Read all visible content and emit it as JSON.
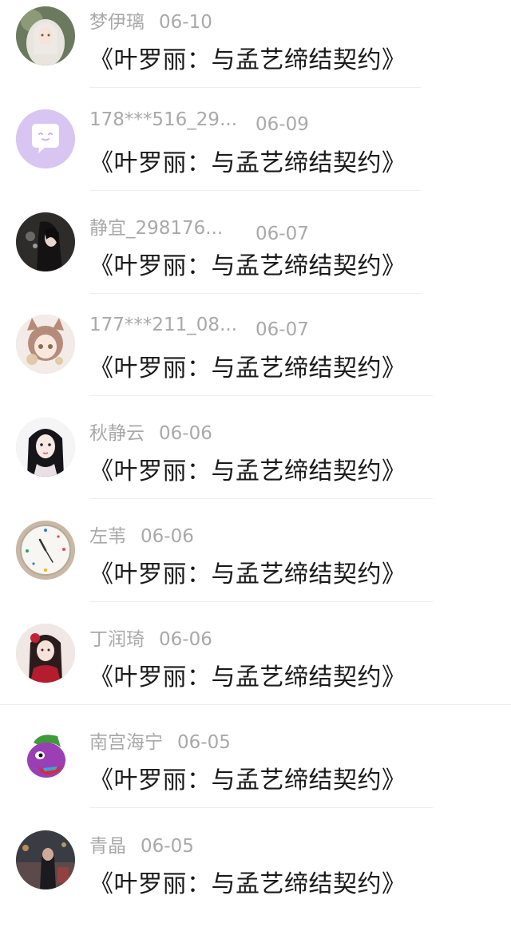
{
  "comments": [
    {
      "name": "梦伊璃",
      "date": "06-10",
      "text": "《叶罗丽：与孟艺缔结契约》",
      "avatar": "girl-white-hair-avatar"
    },
    {
      "name": "178***516_29...",
      "date": "06-09",
      "text": "《叶罗丽：与孟艺缔结契约》",
      "avatar": "default-chat-avatar",
      "avatar_color": "#d9c5f2"
    },
    {
      "name": "静宜_298176...",
      "date": "06-07",
      "text": "《叶罗丽：与孟艺缔结契约》",
      "avatar": "dark-hair-anime-avatar"
    },
    {
      "name": "177***211_08...",
      "date": "06-07",
      "text": "《叶罗丽：与孟艺缔结契约》",
      "avatar": "cat-ear-girl-avatar"
    },
    {
      "name": "秋静云",
      "date": "06-06",
      "text": "《叶罗丽：与孟艺缔结契约》",
      "avatar": "black-hair-girl-avatar"
    },
    {
      "name": "左苇",
      "date": "06-06",
      "text": "《叶罗丽：与孟艺缔结契约》",
      "avatar": "clock-avatar"
    },
    {
      "name": "丁润琦",
      "date": "06-06",
      "text": "《叶罗丽：与孟艺缔结契约》",
      "avatar": "red-dress-girl-avatar"
    },
    {
      "name": "南宫海宁",
      "date": "06-05",
      "text": "《叶罗丽：与孟艺缔结契约》",
      "avatar": "purple-cartoon-avatar"
    },
    {
      "name": "青晶",
      "date": "06-05",
      "text": "《叶罗丽：与孟艺缔结契约》",
      "avatar": "night-scene-avatar"
    }
  ],
  "colors": {
    "meta_text": "#a9a9a9",
    "body_text": "#1a1a1a",
    "divider": "#eeeeee"
  }
}
